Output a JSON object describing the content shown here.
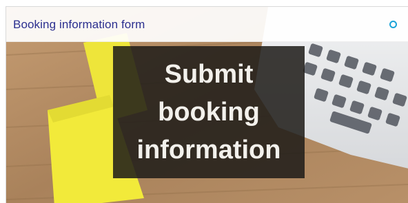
{
  "card": {
    "title": "Booking information form",
    "image_text": [
      "Submit",
      "booking",
      "information"
    ]
  },
  "colors": {
    "title": "#2b2f8f",
    "status_ring": "#1aa3d8",
    "overlay": "#1e1c18",
    "sticky_note": "#f2ea3a",
    "desk": "#b08a62"
  },
  "icons": {
    "status": "status-circle-icon"
  }
}
